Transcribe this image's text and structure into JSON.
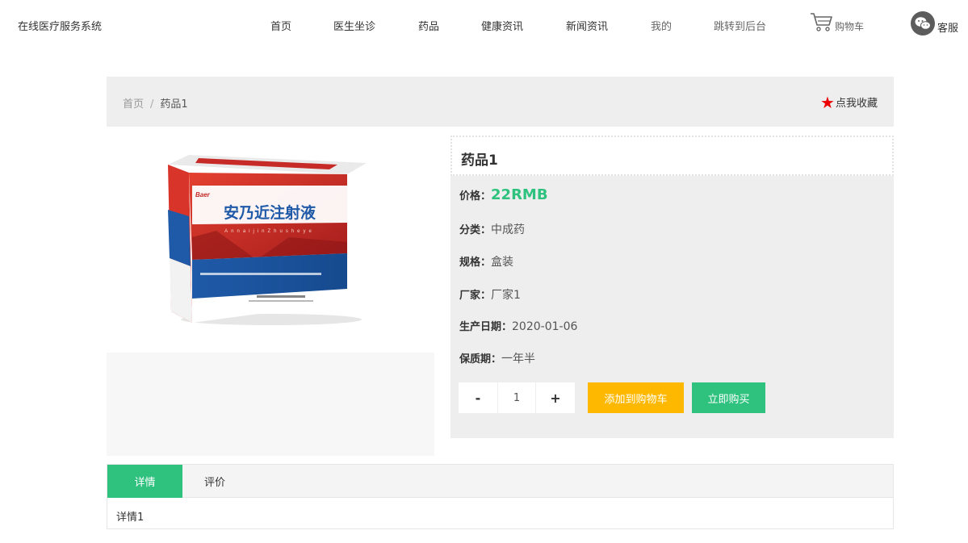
{
  "header": {
    "brand": "在线医疗服务系统",
    "nav": [
      {
        "label": "首页"
      },
      {
        "label": "医生坐诊"
      },
      {
        "label": "药品"
      },
      {
        "label": "健康资讯"
      },
      {
        "label": "新闻资讯"
      },
      {
        "label": "我的"
      },
      {
        "label": "跳转到后台"
      }
    ],
    "cart_label": "购物车",
    "service_label": "客服"
  },
  "breadcrumb": {
    "home": "首页",
    "separator": "/",
    "current": "药品1"
  },
  "favorite_label": "点我收藏",
  "product": {
    "name": "药品1",
    "box_title": "安乃近注射液",
    "box_brand": "Baer",
    "box_pinyin": "AnnaijinZhusheye",
    "fields": [
      {
        "key": "价格：",
        "value": "22RMB"
      },
      {
        "key": "分类：",
        "value": "中成药"
      },
      {
        "key": "规格：",
        "value": "盒装"
      },
      {
        "key": "厂家：",
        "value": "厂家1"
      },
      {
        "key": "生产日期：",
        "value": "2020-01-06"
      },
      {
        "key": "保质期：",
        "value": "一年半"
      }
    ],
    "quantity": "1",
    "minus": "-",
    "plus": "+",
    "add_to_cart": "添加到购物车",
    "buy_now": "立即购买"
  },
  "tabs": {
    "items": [
      {
        "label": "详情"
      },
      {
        "label": "评价"
      }
    ],
    "active_index": 0,
    "content": "详情1"
  },
  "colors": {
    "accent": "#2ec27e",
    "warning": "#ffb800",
    "favorite_star": "#ee0000"
  }
}
